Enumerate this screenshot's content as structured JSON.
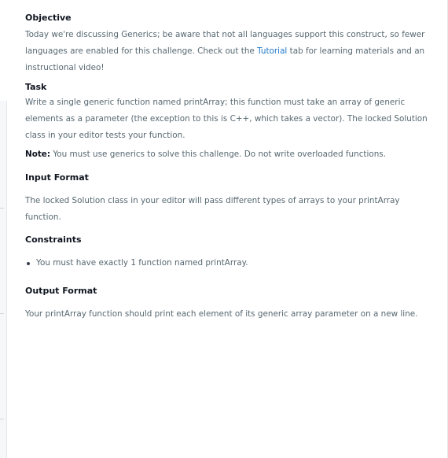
{
  "objective": {
    "heading": "Objective",
    "text_before_link": "Today we're discussing Generics; be aware that not all languages support this construct, so fewer languages are enabled for this challenge. Check out the ",
    "link_label": "Tutorial",
    "text_after_link": " tab for learning materials and an instructional video!"
  },
  "task": {
    "heading": "Task",
    "text": "Write a single generic function named printArray; this function must take an array of generic elements as a parameter (the exception to this is C++, which takes a vector). The locked Solution class in your editor tests your function.",
    "note_label": "Note:",
    "note_text": " You must use generics to solve this challenge. Do not write overloaded functions."
  },
  "input_format": {
    "heading": "Input Format",
    "text": "The locked Solution class in your editor will pass different types of arrays to your printArray function."
  },
  "constraints": {
    "heading": "Constraints",
    "items": [
      "You must have exactly 1 function named printArray."
    ]
  },
  "output_format": {
    "heading": "Output Format",
    "text": "Your printArray function should print each element of its generic array parameter on a new line."
  },
  "colors": {
    "link": "#1f77c8",
    "heading": "#0e141e",
    "body_text": "#576871"
  }
}
